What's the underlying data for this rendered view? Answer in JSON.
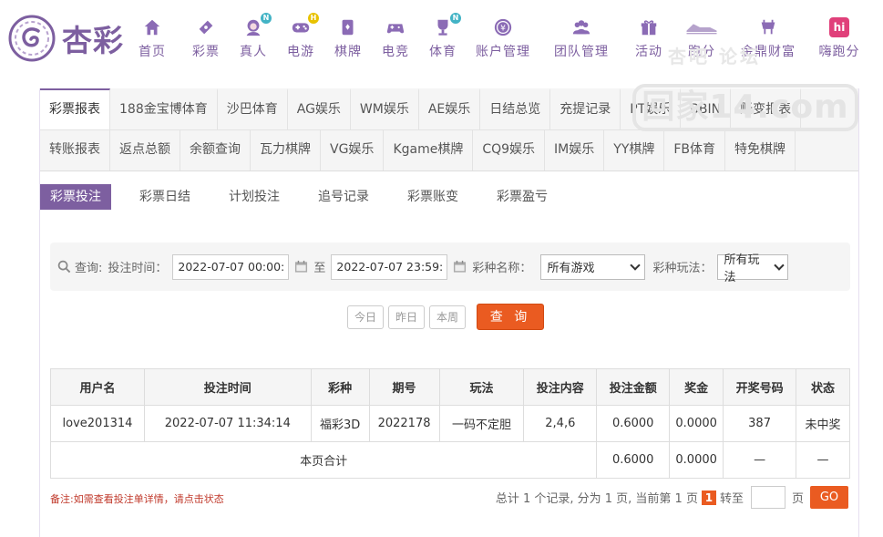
{
  "brand": {
    "name": "杏彩",
    "color": "#7d5fa0",
    "accent": "#ea5b21"
  },
  "nav": [
    {
      "label": "首页",
      "icon": "home-icon",
      "badge": ""
    },
    {
      "label": "彩票",
      "icon": "lottery-ticket-icon",
      "badge": ""
    },
    {
      "label": "真人",
      "icon": "live-dealer-icon",
      "badge": "N"
    },
    {
      "label": "电游",
      "icon": "gamepad-icon",
      "badge": "H"
    },
    {
      "label": "棋牌",
      "icon": "cards-icon",
      "badge": ""
    },
    {
      "label": "电竞",
      "icon": "esports-controller-icon",
      "badge": ""
    },
    {
      "label": "体育",
      "icon": "trophy-icon",
      "badge": "N"
    },
    {
      "label": "账户管理",
      "icon": "coin-icon",
      "badge": ""
    },
    {
      "label": "团队管理",
      "icon": "team-icon",
      "badge": ""
    },
    {
      "label": "活动",
      "icon": "gift-icon",
      "badge": ""
    },
    {
      "label": "跑分",
      "icon": "running-shoe-icon",
      "badge": ""
    },
    {
      "label": "金鼎财富",
      "icon": "ding-icon",
      "badge": ""
    },
    {
      "label": "嗨跑分",
      "icon": "hi-icon",
      "badge": ""
    }
  ],
  "tabs_row1": [
    "彩票报表",
    "188金宝博体育",
    "沙巴体育",
    "AG娱乐",
    "WM娱乐",
    "AE娱乐",
    "日结总览",
    "充提记录",
    "PT娱乐",
    "BBIN",
    "账变报表"
  ],
  "tabs_row2": [
    "转账报表",
    "返点总额",
    "余额查询",
    "瓦力棋牌",
    "VG娱乐",
    "Kgame棋牌",
    "CQ9娱乐",
    "IM娱乐",
    "YY棋牌",
    "FB体育",
    "特免棋牌"
  ],
  "subtabs": [
    "彩票投注",
    "彩票日结",
    "计划投注",
    "追号记录",
    "彩票账变",
    "彩票盈亏"
  ],
  "search": {
    "query_label": "查询:",
    "time_label": "投注时间：",
    "start_time": "2022-07-07 00:00:00",
    "to_label": "至",
    "end_time": "2022-07-07 23:59:59",
    "lottery_label": "彩种名称：",
    "lottery_value": "所有游戏",
    "play_label": "彩种玩法：",
    "play_value": "所有玩法"
  },
  "quick": {
    "today": "今日",
    "yesterday": "昨日",
    "week": "本周",
    "query": "查 询"
  },
  "table": {
    "headers": [
      "用户名",
      "投注时间",
      "彩种",
      "期号",
      "玩法",
      "投注内容",
      "投注金额",
      "奖金",
      "开奖号码",
      "状态"
    ],
    "rows": [
      [
        "love201314",
        "2022-07-07 11:34:14",
        "福彩3D",
        "2022178",
        "一码不定胆",
        "2,4,6",
        "0.6000",
        "0.0000",
        "387",
        "未中奖"
      ]
    ],
    "total": {
      "label": "本页合计",
      "amount": "0.6000",
      "bonus": "0.0000",
      "draw": "—",
      "state": "—"
    }
  },
  "note": "备注:如需查看投注单详情，请点击状态",
  "pager": {
    "summary": "总计 1 个记录, 分为 1 页, 当前第 1 页",
    "current": "1",
    "goto_label": "转至",
    "page_unit": "页",
    "go": "GO"
  },
  "watermark": {
    "top": "杏吧  论坛",
    "main": "回家14.com"
  }
}
